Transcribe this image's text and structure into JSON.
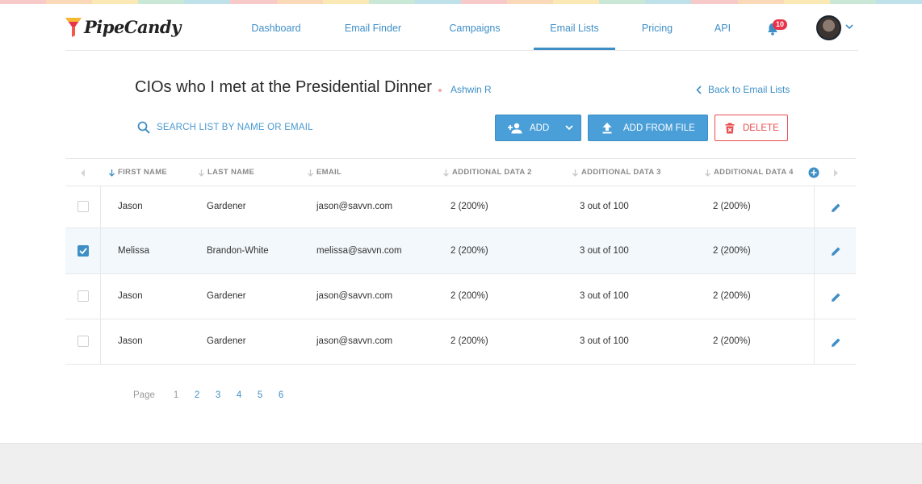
{
  "brand": {
    "name": "PipeCandy"
  },
  "nav": {
    "items": [
      {
        "label": "Dashboard"
      },
      {
        "label": "Email Finder"
      },
      {
        "label": "Campaigns"
      },
      {
        "label": "Email Lists"
      },
      {
        "label": "Pricing"
      },
      {
        "label": "API"
      }
    ],
    "active": "Email Lists",
    "notifications_count": "10"
  },
  "list": {
    "title": "CIOs who I met at the Presidential Dinner",
    "owner": "Ashwin R",
    "back_label": "Back to Email Lists"
  },
  "search": {
    "placeholder": "SEARCH LIST BY NAME OR EMAIL"
  },
  "actions": {
    "add_label": "ADD",
    "add_from_file_label": "ADD FROM FILE",
    "delete_label": "DELETE"
  },
  "table": {
    "columns": [
      "FIRST NAME",
      "LAST NAME",
      "EMAIL",
      "ADDITIONAL DATA 2",
      "ADDITIONAL DATA 3",
      "ADDITIONAL DATA 4"
    ],
    "rows": [
      {
        "checked": false,
        "cells": [
          "Jason",
          "Gardener",
          "jason@savvn.com",
          "2 (200%)",
          "3 out of 100",
          "2 (200%)"
        ]
      },
      {
        "checked": true,
        "cells": [
          "Melissa",
          "Brandon-White",
          "melissa@savvn.com",
          "2 (200%)",
          "3 out of 100",
          "2 (200%)"
        ]
      },
      {
        "checked": false,
        "cells": [
          "Jason",
          "Gardener",
          "jason@savvn.com",
          "2 (200%)",
          "3 out of 100",
          "2 (200%)"
        ]
      },
      {
        "checked": false,
        "cells": [
          "Jason",
          "Gardener",
          "jason@savvn.com",
          "2 (200%)",
          "3 out of 100",
          "2 (200%)"
        ]
      }
    ]
  },
  "pagination": {
    "label": "Page",
    "pages": [
      "1",
      "2",
      "3",
      "4",
      "5",
      "6"
    ],
    "current": "1"
  },
  "colors": {
    "accent": "#3f8fc7",
    "button": "#4a9fd8",
    "danger": "#e84c4c",
    "badge": "#e8334a",
    "selected_row": "#f3f8fc"
  }
}
